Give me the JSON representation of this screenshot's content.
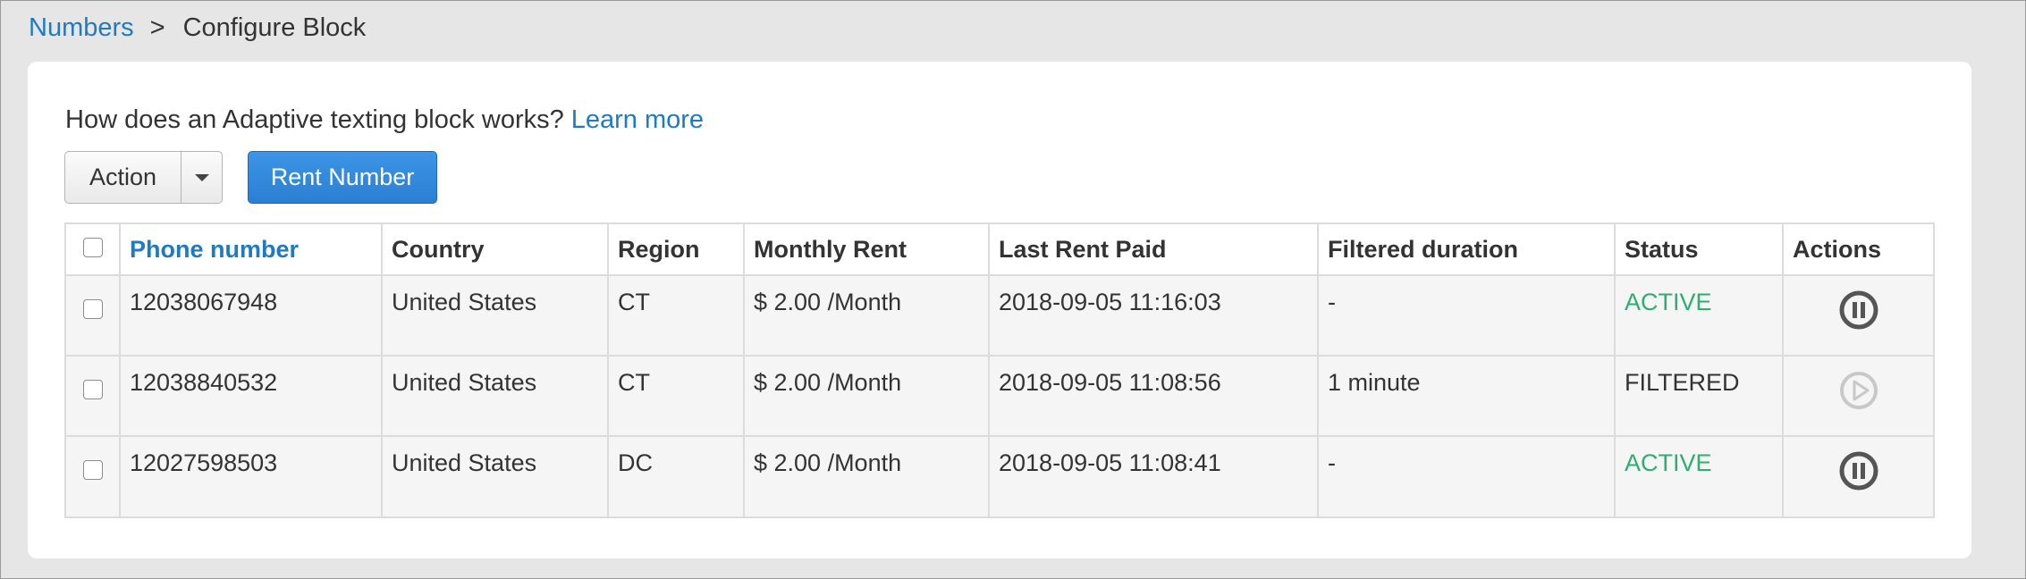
{
  "breadcrumb": {
    "parent": "Numbers",
    "separator": ">",
    "current": "Configure Block"
  },
  "intro": {
    "question": "How does an Adaptive texting block works?",
    "learn_more": "Learn more"
  },
  "toolbar": {
    "action_label": "Action",
    "rent_label": "Rent Number"
  },
  "table": {
    "headers": {
      "phone": "Phone number",
      "country": "Country",
      "region": "Region",
      "rent": "Monthly Rent",
      "paid": "Last Rent Paid",
      "filtered": "Filtered duration",
      "status": "Status",
      "actions": "Actions"
    },
    "rows": [
      {
        "phone": "12038067948",
        "country": "United States",
        "region": "CT",
        "rent": "$ 2.00 /Month",
        "paid": "2018-09-05 11:16:03",
        "filtered": "-",
        "status": "ACTIVE",
        "action_icon": "pause-icon"
      },
      {
        "phone": "12038840532",
        "country": "United States",
        "region": "CT",
        "rent": "$ 2.00 /Month",
        "paid": "2018-09-05 11:08:56",
        "filtered": "1 minute",
        "status": "FILTERED",
        "action_icon": "play-icon"
      },
      {
        "phone": "12027598503",
        "country": "United States",
        "region": "DC",
        "rent": "$ 2.00 /Month",
        "paid": "2018-09-05 11:08:41",
        "filtered": "-",
        "status": "ACTIVE",
        "action_icon": "pause-icon"
      }
    ]
  },
  "colors": {
    "link": "#1f7bc1",
    "primary_button": "#2a7fd4",
    "status_active": "#2fae72",
    "pause_icon": "#555555",
    "play_icon_disabled": "#c8c8c8"
  }
}
